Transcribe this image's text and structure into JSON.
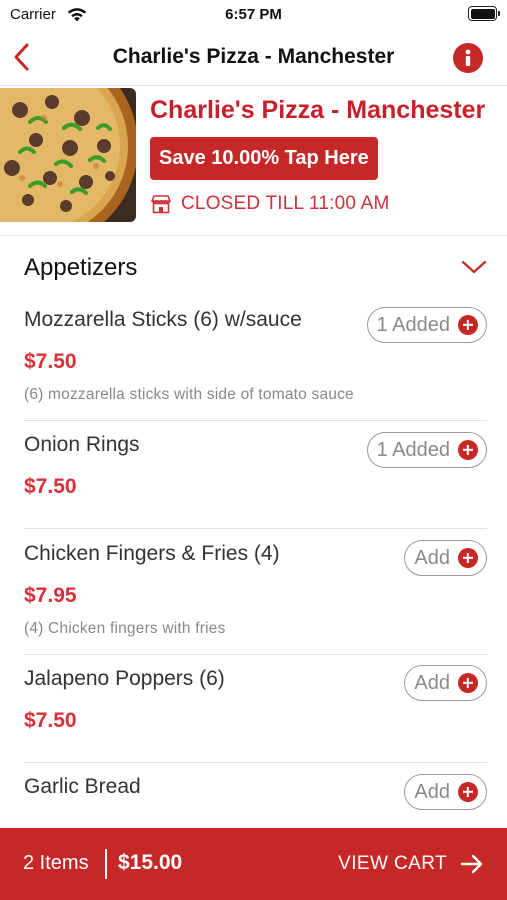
{
  "status_bar": {
    "carrier": "Carrier",
    "time": "6:57 PM"
  },
  "nav": {
    "title": "Charlie's Pizza - Manchester",
    "back_icon": "chevron-left-icon",
    "info_icon": "info-icon"
  },
  "restaurant": {
    "name": "Charlie's Pizza - Manchester",
    "promo_label": "Save 10.00% Tap Here",
    "status": "CLOSED TILL 11:00 AM",
    "image": "pizza-photo"
  },
  "section": {
    "title": "Appetizers",
    "expanded": true
  },
  "items": [
    {
      "name": "Mozzarella Sticks (6) w/sauce",
      "price": "$7.50",
      "description": "(6) mozzarella sticks with side of tomato sauce",
      "button_label": "1 Added"
    },
    {
      "name": "Onion Rings",
      "price": "$7.50",
      "description": "",
      "button_label": "1 Added"
    },
    {
      "name": "Chicken Fingers & Fries (4)",
      "price": "$7.95",
      "description": "(4) Chicken fingers with fries",
      "button_label": "Add"
    },
    {
      "name": "Jalapeno Poppers (6)",
      "price": "$7.50",
      "description": "",
      "button_label": "Add"
    },
    {
      "name": "Garlic Bread",
      "price": "",
      "description": "",
      "button_label": "Add"
    }
  ],
  "cart": {
    "count_label": "2 Items",
    "total": "$15.00",
    "view_label": "VIEW CART"
  },
  "colors": {
    "brand_red": "#c62828",
    "price_red": "#d8303a"
  }
}
